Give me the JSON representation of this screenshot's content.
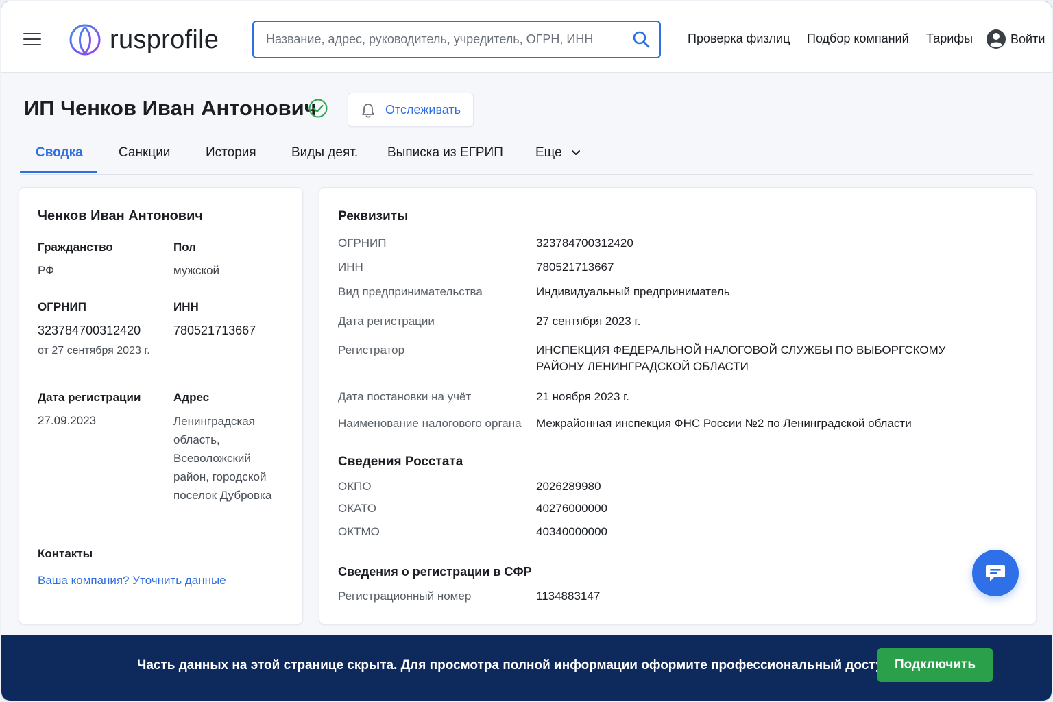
{
  "brand": {
    "name": "rusprofile"
  },
  "search": {
    "placeholder": "Название, адрес, руководитель, учредитель, ОГРН, ИНН"
  },
  "nav": {
    "check_person": "Проверка физлиц",
    "company_select": "Подбор компаний",
    "tariffs": "Тарифы",
    "login": "Войти"
  },
  "page": {
    "title": "ИП Ченков Иван Антонович",
    "track_label": "Отслеживать"
  },
  "tabs": [
    {
      "label": "Сводка",
      "active": true
    },
    {
      "label": "Санкции"
    },
    {
      "label": "История"
    },
    {
      "label": "Виды деят."
    },
    {
      "label": "Выписка из ЕГРИП"
    },
    {
      "label": "Еще"
    }
  ],
  "summary": {
    "name": "Ченков Иван Антонович",
    "citizenship_label": "Гражданство",
    "citizenship": "РФ",
    "sex_label": "Пол",
    "sex": "мужской",
    "ogrnip_label": "ОГРНИП",
    "ogrnip": "323784700312420",
    "ogrnip_date": "от 27 сентября 2023 г.",
    "inn_label": "ИНН",
    "inn": "780521713667",
    "reg_date_label": "Дата регистрации",
    "reg_date": "27.09.2023",
    "address_label": "Адрес",
    "address": "Ленинградская область, Всеволожский район, городской поселок Дубровка",
    "contacts_label": "Контакты",
    "contacts_link": "Ваша компания? Уточнить данные"
  },
  "requisites": {
    "title": "Реквизиты",
    "rows": [
      {
        "label": "ОГРНИП",
        "value": "323784700312420"
      },
      {
        "label": "ИНН",
        "value": "780521713667"
      },
      {
        "label": "Вид предпринимательства",
        "value": "Индивидуальный предприниматель"
      },
      {
        "label": "Дата регистрации",
        "value": "27 сентября 2023 г."
      },
      {
        "label": "Регистратор",
        "value": "ИНСПЕКЦИЯ ФЕДЕРАЛЬНОЙ НАЛОГОВОЙ СЛУЖБЫ ПО ВЫБОРГСКОМУ РАЙОНУ ЛЕНИНГРАДСКОЙ ОБЛАСТИ"
      },
      {
        "label": "Дата постановки на учёт",
        "value": "21 ноября 2023 г."
      },
      {
        "label": "Наименование налогового органа",
        "value": "Межрайонная инспекция ФНС России №2 по Ленинградской области"
      }
    ]
  },
  "rosstat": {
    "title": "Сведения Росстата",
    "rows": [
      {
        "label": "ОКПО",
        "value": "2026289980"
      },
      {
        "label": "ОКАТО",
        "value": "40276000000"
      },
      {
        "label": "ОКТМО",
        "value": "40340000000"
      }
    ]
  },
  "sfr": {
    "title": "Сведения о регистрации в СФР",
    "rows": [
      {
        "label": "Регистрационный номер",
        "value": "1134883147"
      }
    ]
  },
  "banner": {
    "text": "Часть данных на этой странице скрыта. Для просмотра полной информации оформите профессиональный доступ.",
    "button": "Подключить"
  },
  "colors": {
    "accent": "#2f6fe0",
    "verified": "#2ea44f",
    "banner_bg": "#0e2a5c",
    "connect_btn": "#2aa04a"
  },
  "icons": [
    "menu-icon",
    "logo-icon",
    "search-icon",
    "user-icon",
    "verified-check-icon",
    "bell-icon",
    "chevron-down-icon",
    "chat-icon"
  ]
}
